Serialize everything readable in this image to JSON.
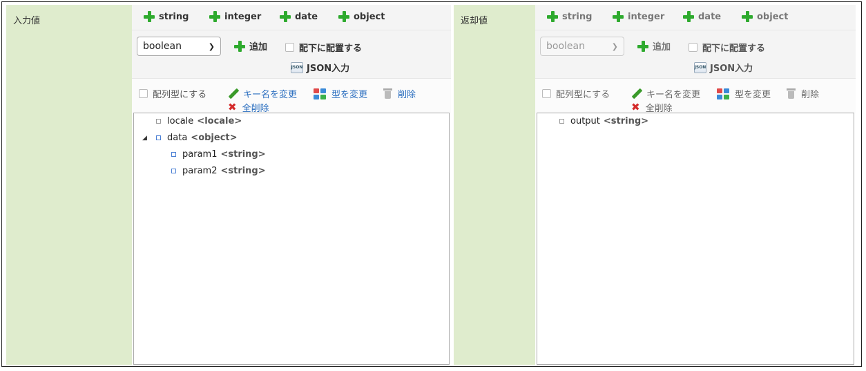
{
  "type_buttons": [
    "string",
    "integer",
    "date",
    "object"
  ],
  "input": {
    "label": "入力値",
    "select_value": "boolean",
    "add_label": "追加",
    "place_under_label": "配下に配置する",
    "json_label": "JSON入力",
    "json_icon_text": "JSON",
    "array_label": "配列型にする",
    "rename_label": "キー名を変更",
    "change_type_label": "型を変更",
    "delete_label": "削除",
    "delete_all_label": "全削除",
    "tree": [
      {
        "key": "locale",
        "type": "<locale>"
      },
      {
        "key": "data",
        "type": "<object>"
      },
      {
        "key": "param1",
        "type": "<string>"
      },
      {
        "key": "param2",
        "type": "<string>"
      }
    ]
  },
  "output": {
    "label": "返却値",
    "select_value": "boolean",
    "add_label": "追加",
    "place_under_label": "配下に配置する",
    "json_label": "JSON入力",
    "json_icon_text": "JSON",
    "array_label": "配列型にする",
    "rename_label": "キー名を変更",
    "change_type_label": "型を変更",
    "delete_label": "削除",
    "delete_all_label": "全削除",
    "tree": [
      {
        "key": "output",
        "type": "<string>"
      }
    ]
  },
  "colors": {
    "label_bg": "#dfeccd",
    "plus": "#2eaa2e",
    "link": "#2a6ebf",
    "delete_all": "#d42b2b"
  }
}
